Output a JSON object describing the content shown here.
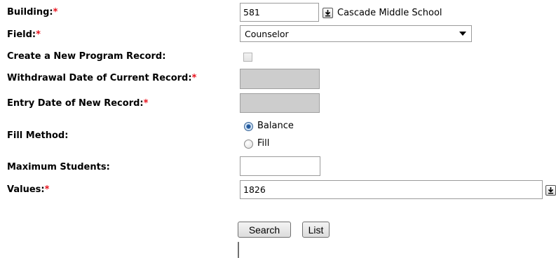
{
  "form": {
    "required_mark": "*",
    "building": {
      "label": "Building:",
      "value": "581",
      "name": "Cascade Middle School"
    },
    "field": {
      "label": "Field:",
      "selected": "Counselor"
    },
    "create_new": {
      "label": "Create a New Program Record:",
      "checked": false
    },
    "withdrawal_date": {
      "label": "Withdrawal Date of Current Record:",
      "value": ""
    },
    "entry_date": {
      "label": "Entry Date of New Record:",
      "value": ""
    },
    "fill_method": {
      "label": "Fill Method:",
      "options": [
        "Balance",
        "Fill"
      ],
      "selected": "Balance"
    },
    "max_students": {
      "label": "Maximum Students:",
      "value": ""
    },
    "values": {
      "label": "Values:",
      "value": "1826"
    }
  },
  "buttons": {
    "search": "Search",
    "list": "List"
  }
}
